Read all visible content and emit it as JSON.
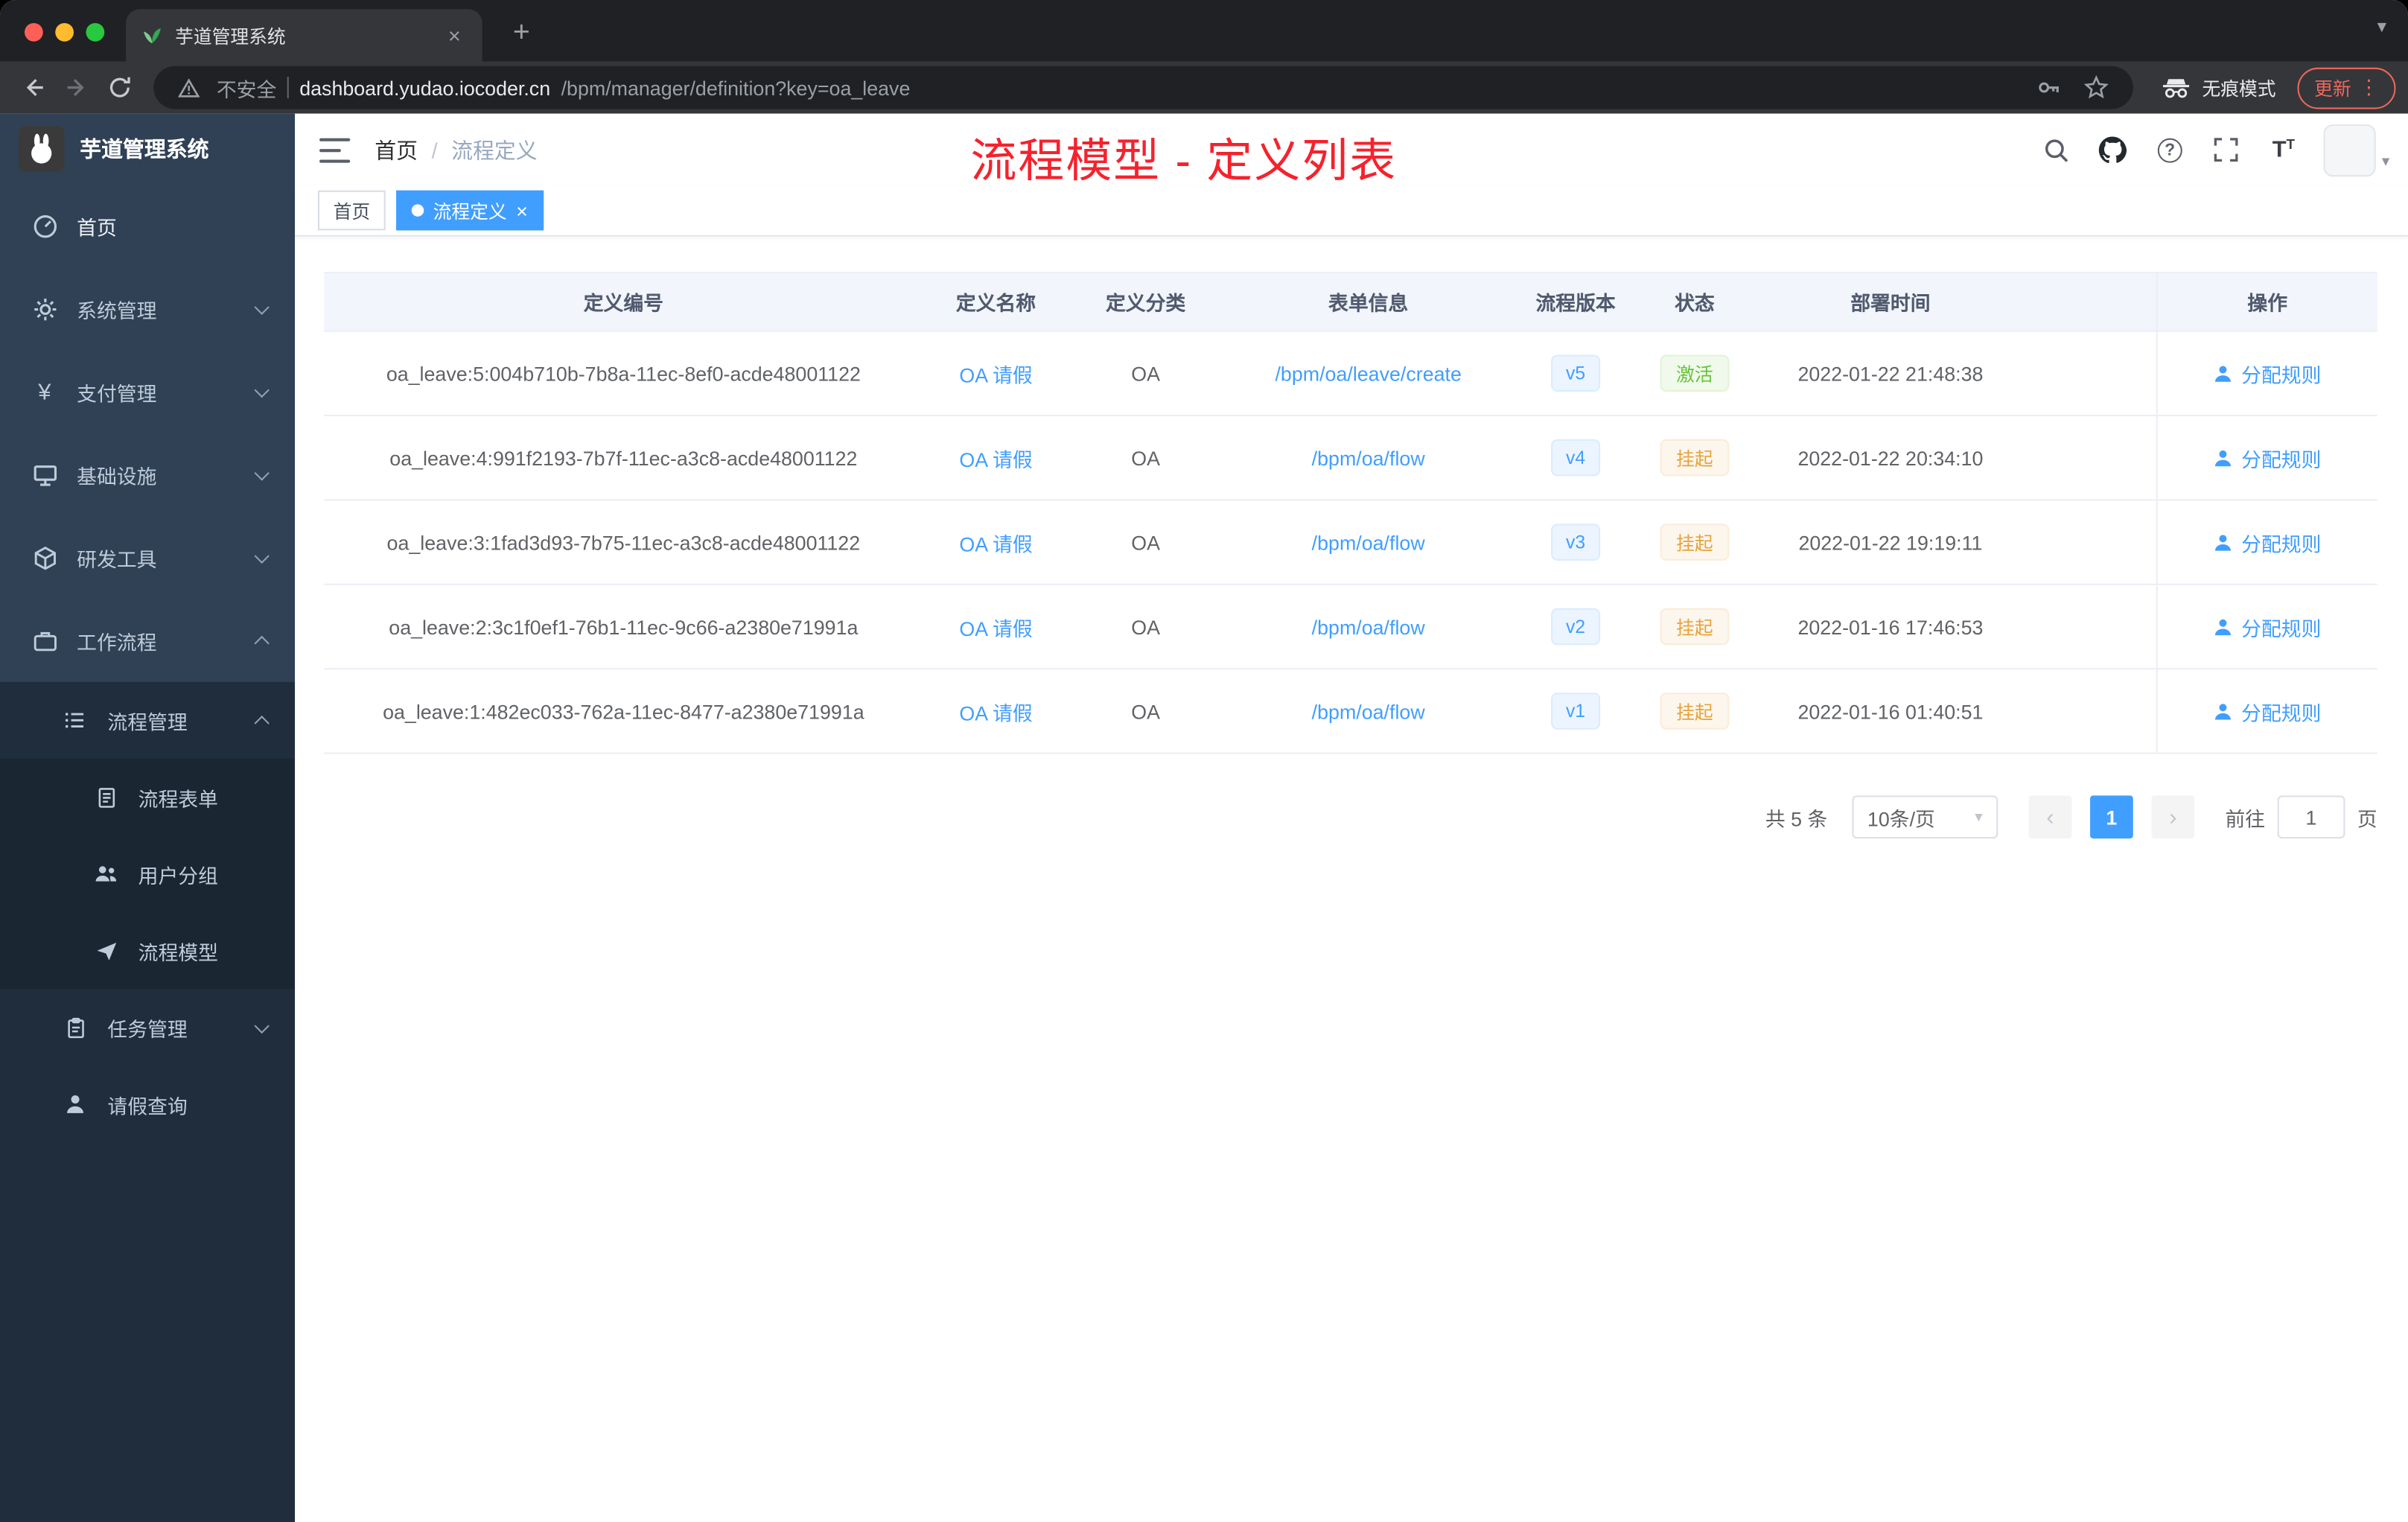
{
  "browser": {
    "tab_title": "芋道管理系统",
    "security_label": "不安全",
    "url_host": "dashboard.yudao.iocoder.cn",
    "url_path": "/bpm/manager/definition?key=oa_leave",
    "incognito_label": "无痕模式",
    "update_label": "更新"
  },
  "icons": {
    "new_tab": "+",
    "tab_close": "×",
    "tab_search": "▾",
    "menu_dots": "⋮",
    "yen": "¥",
    "question": "?",
    "font_big": "T",
    "font_small": "T",
    "avatar_caret": "▾",
    "select_caret": "▾",
    "prev": "‹",
    "next": "›",
    "tag_close": "×"
  },
  "colors": {
    "accent": "#409eff",
    "success": "#67c23a",
    "warning": "#e6a23c",
    "annotation_red": "#f5222d",
    "sidebar_bg": "#304156",
    "submenu_bg": "#1f2d3d"
  },
  "sidebar": {
    "logo_title": "芋道管理系统",
    "items": [
      {
        "label": "首页"
      },
      {
        "label": "系统管理"
      },
      {
        "label": "支付管理"
      },
      {
        "label": "基础设施"
      },
      {
        "label": "研发工具"
      },
      {
        "label": "工作流程"
      }
    ],
    "workflow_children": [
      {
        "label": "流程管理"
      },
      {
        "label": "任务管理"
      },
      {
        "label": "请假查询"
      }
    ],
    "process_children": [
      {
        "label": "流程表单"
      },
      {
        "label": "用户分组"
      },
      {
        "label": "流程模型"
      }
    ]
  },
  "header": {
    "breadcrumb_home": "首页",
    "breadcrumb_sep": "/",
    "breadcrumb_current": "流程定义",
    "annotation": "流程模型 - 定义列表"
  },
  "tags": [
    {
      "label": "首页"
    },
    {
      "label": "流程定义"
    }
  ],
  "table": {
    "columns": [
      "定义编号",
      "定义名称",
      "定义分类",
      "表单信息",
      "流程版本",
      "状态",
      "部署时间",
      "操作"
    ],
    "rows": [
      {
        "id": "oa_leave:5:004b710b-7b8a-11ec-8ef0-acde48001122",
        "name": "OA 请假",
        "category": "OA",
        "form": "/bpm/oa/leave/create",
        "version": "v5",
        "status": "激活",
        "time": "2022-01-22 21:48:38",
        "action": "分配规则"
      },
      {
        "id": "oa_leave:4:991f2193-7b7f-11ec-a3c8-acde48001122",
        "name": "OA 请假",
        "category": "OA",
        "form": "/bpm/oa/flow",
        "version": "v4",
        "status": "挂起",
        "time": "2022-01-22 20:34:10",
        "action": "分配规则"
      },
      {
        "id": "oa_leave:3:1fad3d93-7b75-11ec-a3c8-acde48001122",
        "name": "OA 请假",
        "category": "OA",
        "form": "/bpm/oa/flow",
        "version": "v3",
        "status": "挂起",
        "time": "2022-01-22 19:19:11",
        "action": "分配规则"
      },
      {
        "id": "oa_leave:2:3c1f0ef1-76b1-11ec-9c66-a2380e71991a",
        "name": "OA 请假",
        "category": "OA",
        "form": "/bpm/oa/flow",
        "version": "v2",
        "status": "挂起",
        "time": "2022-01-16 17:46:53",
        "action": "分配规则"
      },
      {
        "id": "oa_leave:1:482ec033-762a-11ec-8477-a2380e71991a",
        "name": "OA 请假",
        "category": "OA",
        "form": "/bpm/oa/flow",
        "version": "v1",
        "status": "挂起",
        "time": "2022-01-16 01:40:51",
        "action": "分配规则"
      }
    ]
  },
  "pagination": {
    "total": "共 5 条",
    "page_size": "10条/页",
    "current": "1",
    "goto_prefix": "前往",
    "goto_value": "1",
    "goto_suffix": "页"
  }
}
